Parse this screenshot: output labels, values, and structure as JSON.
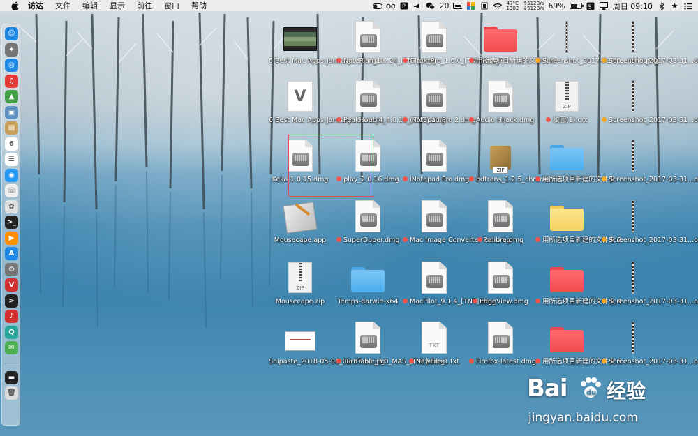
{
  "menubar": {
    "app_name": "访达",
    "menus": [
      "文件",
      "编辑",
      "显示",
      "前往",
      "窗口",
      "帮助"
    ],
    "status": {
      "badge_count": "20",
      "temperature": "47°C",
      "fan": "1302",
      "net_up": "↑512B/s",
      "net_down": "↓512B/s",
      "battery_percent": "69%",
      "battery_level": 0.69,
      "datetime": "周日 09:10"
    }
  },
  "dock": {
    "items": [
      "finder",
      "launchpad",
      "safari",
      "netease-music",
      "android-studio",
      "preview",
      "notes",
      "calendar",
      "reminders",
      "spotlight",
      "contacts",
      "photos",
      "terminal",
      "vlc",
      "app-store",
      "system-prefs",
      "vivaldi",
      "iterm",
      "music",
      "qq",
      "wechat",
      "terminal-2",
      "trash"
    ]
  },
  "desktop": {
    "columns": [
      [
        {
          "label": "6 Best Mac Apps-January...06.mp4",
          "kind": "video"
        },
        {
          "label": "6 Best Mac Apps-January...6.webm",
          "kind": "vector"
        },
        {
          "label": "Keka-1.0.15.dmg",
          "kind": "dmg"
        },
        {
          "label": "Mousecape.app",
          "kind": "app"
        },
        {
          "label": "Mousecape.zip",
          "kind": "zip"
        },
        {
          "label": "Snipaste_2018-05-06_09-07-51.jpg",
          "kind": "snip"
        }
      ],
      [
        {
          "label": "NotePlan_1.6.24_[TNT].dmg",
          "kind": "dmg",
          "tag": "red"
        },
        {
          "label": "PeakHour_4_4.0.10_[TNT].dmg",
          "kind": "dmg",
          "tag": "red"
        },
        {
          "label": "play_2.0.16.dmg",
          "kind": "dmg",
          "tag": "red"
        },
        {
          "label": "SuperDuper.dmg",
          "kind": "dmg",
          "tag": "red"
        },
        {
          "label": "Temps-darwin-x64",
          "kind": "folder-blue"
        },
        {
          "label": "TurnTable_3.0_MAS_[TNT].dmg",
          "kind": "dmg",
          "tag": "red"
        }
      ],
      [
        {
          "label": "Girox_Pro_1.6.0_[TNT].dmg",
          "kind": "dmg",
          "tag": "red"
        },
        {
          "label": "iNotepad Pro 2.dmg",
          "kind": "dmg",
          "tag": "red"
        },
        {
          "label": "iNotepad Pro.dmg",
          "kind": "dmg",
          "tag": "red"
        },
        {
          "label": "Mac Image Converter Pro.dmg",
          "kind": "dmg",
          "tag": "red"
        },
        {
          "label": "MacPilot_9.1.4_[TNT].dmg",
          "kind": "dmg",
          "tag": "red"
        },
        {
          "label": "NewFile-1.txt",
          "kind": "txt",
          "tag": "red"
        }
      ],
      [
        {
          "label": "用所选项目新建的文件夹 6",
          "kind": "folder-red",
          "tag": "red"
        },
        {
          "label": "Audio Hijack.dmg",
          "kind": "dmg",
          "tag": "red"
        },
        {
          "label": "bdtrans_1.2.5_chrome.crx",
          "kind": "crx",
          "tag": "red"
        },
        {
          "label": "calibre.dmg",
          "kind": "dmg",
          "tag": "red"
        },
        {
          "label": "EdgeView.dmg",
          "kind": "dmg",
          "tag": "red"
        },
        {
          "label": "Firefox-latest.dmg",
          "kind": "dmg",
          "tag": "red"
        }
      ],
      [
        {
          "label": "Screenshot_2017-03-31...obile.png",
          "kind": "strip",
          "tag": "orange"
        },
        {
          "label": "校园(1).crx",
          "kind": "zip",
          "tag": "red"
        },
        {
          "label": "用所选项目新建的文件夹",
          "kind": "folder-blue",
          "tag": "red"
        },
        {
          "label": "用所选项目新建的文件夹 2",
          "kind": "folder-yellow",
          "tag": "red"
        },
        {
          "label": "用所选项目新建的文件夹 4",
          "kind": "folder-red",
          "tag": "red"
        },
        {
          "label": "用所选项目新建的文件夹 5",
          "kind": "folder-red",
          "tag": "red"
        }
      ],
      [
        {
          "label": "Screenshot_2017-03-31...obile.png",
          "kind": "strip",
          "tag": "orange"
        },
        {
          "label": "Screenshot_2017-03-31...obile.png",
          "kind": "strip",
          "tag": "orange"
        },
        {
          "label": "Screenshot_2017-03-31...obile.png",
          "kind": "strip",
          "tag": "orange"
        },
        {
          "label": "Screenshot_2017-03-31...obile.png",
          "kind": "strip",
          "tag": "orange"
        },
        {
          "label": "Screenshot_2017-03-31...obile.png",
          "kind": "strip",
          "tag": "orange"
        },
        {
          "label": "Screenshot_2017-03-31...obile.png",
          "kind": "strip",
          "tag": "orange"
        }
      ]
    ]
  },
  "watermark": {
    "brand": "Bai",
    "cn": "经验",
    "url": "jingyan.baidu.com"
  }
}
